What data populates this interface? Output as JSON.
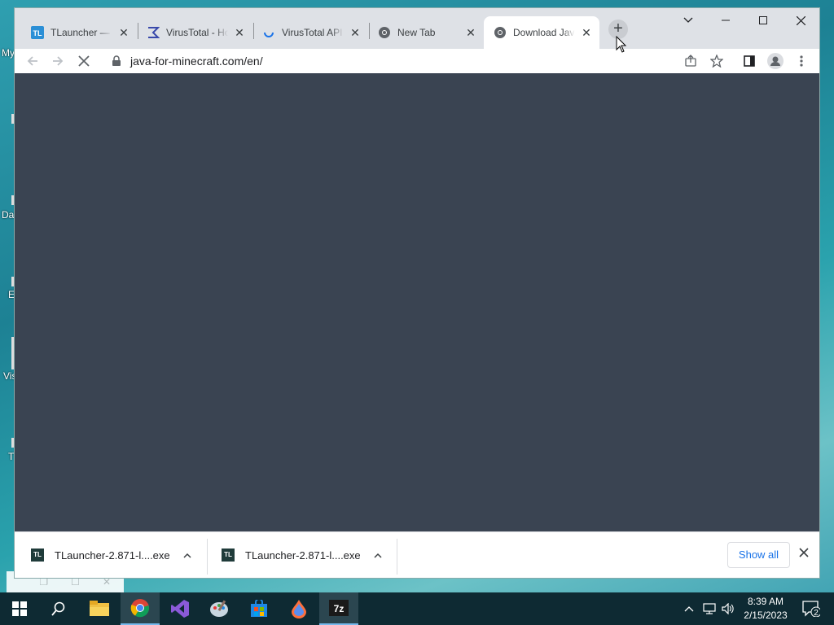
{
  "desktop": {
    "fragments": [
      "My",
      "Da",
      "E",
      "Vis",
      "T"
    ]
  },
  "browser": {
    "tabs": [
      {
        "title": "TLauncher — D",
        "icon": "tlauncher-icon",
        "active": false
      },
      {
        "title": "VirusTotal - Ho",
        "icon": "virustotal-icon",
        "active": false
      },
      {
        "title": "VirusTotal API",
        "icon": "loading-spinner-icon",
        "active": false
      },
      {
        "title": "New Tab",
        "icon": "chrome-icon",
        "active": false
      },
      {
        "title": "Download Java",
        "icon": "chrome-icon",
        "active": true
      }
    ],
    "new_tab_label": "+",
    "address": "java-for-minecraft.com/en/",
    "content_color": "#3a4452"
  },
  "downloads": {
    "items": [
      {
        "name": "TLauncher-2.871-l....exe",
        "icon_text": "TL"
      },
      {
        "name": "TLauncher-2.871-l....exe",
        "icon_text": "TL"
      }
    ],
    "show_all_label": "Show all"
  },
  "taskbar": {
    "apps": [
      "start-icon",
      "search-icon",
      "file-explorer-icon",
      "chrome-icon",
      "visual-studio-icon",
      "paint-icon",
      "store-icon",
      "paint-3d-icon",
      "7zip-icon"
    ],
    "time": "8:39 AM",
    "date": "2/15/2023",
    "notification_count": "2",
    "zip_label": "7z"
  }
}
